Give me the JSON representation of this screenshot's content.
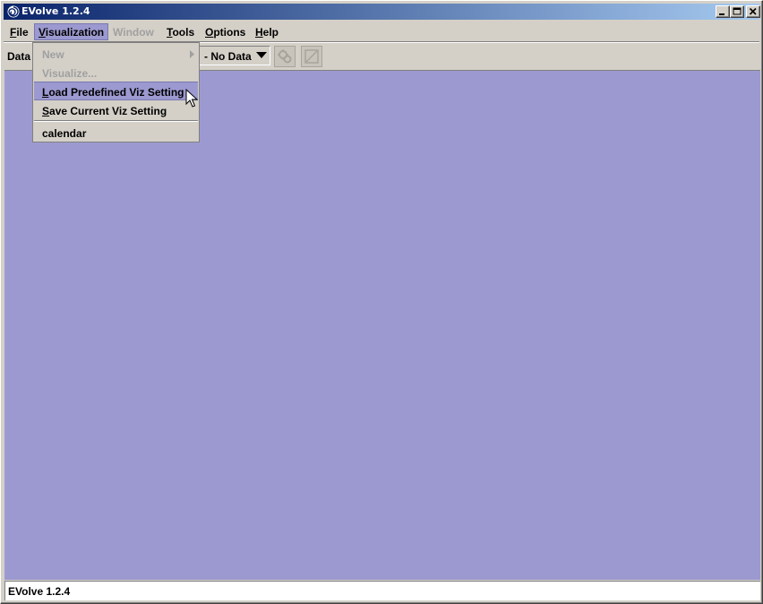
{
  "window": {
    "title": "EVolve 1.2.4",
    "icon": "evolve-app-icon",
    "controls": [
      "minimize-icon",
      "maximize-icon",
      "close-icon"
    ]
  },
  "menubar": {
    "file": {
      "mnemonic": "F",
      "rest": "ile"
    },
    "visualization": {
      "mnemonic": "V",
      "rest": "isualization"
    },
    "window": {
      "mnemonic": "W",
      "rest": "indow"
    },
    "tools": {
      "mnemonic": "T",
      "rest": "ools"
    },
    "options": {
      "mnemonic": "O",
      "rest": "ptions"
    },
    "help": {
      "mnemonic": "H",
      "rest": "elp"
    }
  },
  "toolbar": {
    "data_label": "Data",
    "data_select_value": "- No Data",
    "run_icon": "run-gear-icon",
    "stop_icon": "stop-icon"
  },
  "visualization_menu": {
    "new": {
      "mnemonic": "N",
      "rest": "ew"
    },
    "visualize": {
      "mnemonic": "V",
      "rest": "isualize..."
    },
    "load": {
      "mnemonic": "L",
      "rest": "oad Predefined Viz Setting"
    },
    "save": {
      "mnemonic": "S",
      "rest": "ave Current Viz Setting"
    },
    "calendar": "calendar"
  },
  "status": {
    "text": "EVolve 1.2.4"
  },
  "colors": {
    "desktop": "#9c99d0",
    "chrome": "#d4d0c8",
    "titlebar_start": "#0a246a",
    "titlebar_end": "#a6caf0",
    "disabled_text": "#a0a0a0"
  }
}
